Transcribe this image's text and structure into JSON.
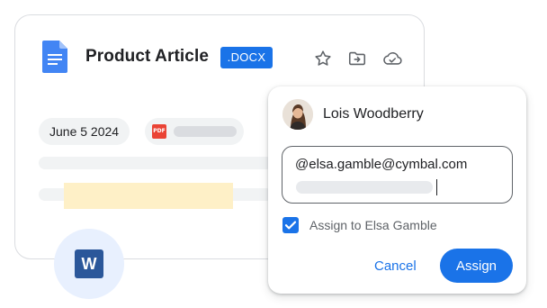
{
  "document": {
    "title": "Product Article",
    "badge": ".DOCX",
    "date_chip": "June 5 2024",
    "file_chip_icon_label": "PDF",
    "toolbar": {
      "star_icon": "star-icon",
      "move_icon": "move-to-folder-icon",
      "cloud_icon": "cloud-sync-icon"
    }
  },
  "word_icon_label": "W",
  "assign_card": {
    "user_name": "Lois Woodberry",
    "mention_text": "@elsa.gamble@cymbal.com",
    "checkbox_checked": true,
    "checkbox_label": "Assign to Elsa Gamble",
    "cancel_label": "Cancel",
    "assign_label": "Assign"
  },
  "colors": {
    "accent": "#1a73e8",
    "docs_blue": "#4285f4",
    "word_blue": "#2b579a",
    "pdf_red": "#ea4335",
    "highlight": "#fef0c7"
  }
}
